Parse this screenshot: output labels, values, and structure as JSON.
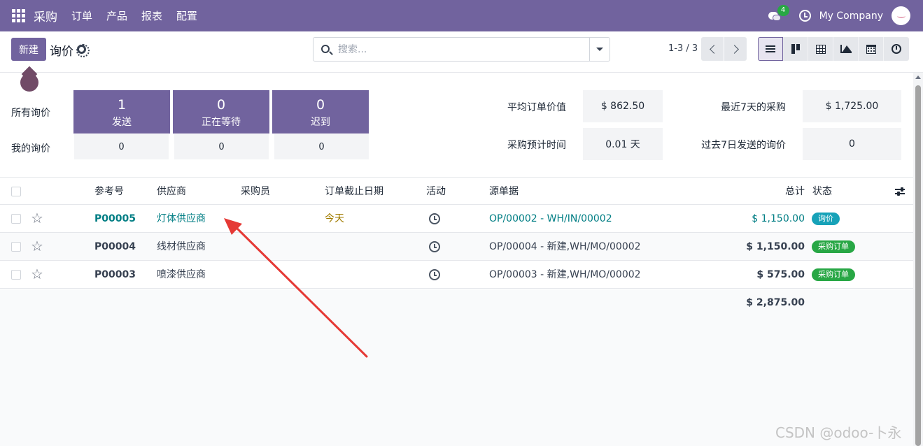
{
  "topbar": {
    "app_name": "采购",
    "menu": [
      "订单",
      "产品",
      "报表",
      "配置"
    ],
    "chat_count": "4",
    "company": "My Company",
    "icons": [
      "apps-grid-icon",
      "chat-icon",
      "clock-icon",
      "avatar"
    ]
  },
  "control": {
    "new_label": "新建",
    "title": "询价",
    "search_placeholder": "搜索...",
    "pager": "1-3 / 3",
    "views": [
      "list-view-icon",
      "kanban-view-icon",
      "pivot-view-icon",
      "graph-view-icon",
      "calendar-view-icon",
      "activity-view-icon"
    ],
    "active_view": "list"
  },
  "dashboard": {
    "row_all": "所有询价",
    "row_mine": "我的询价",
    "tiles": [
      {
        "count": "1",
        "label": "发送",
        "mine": "0"
      },
      {
        "count": "0",
        "label": "正在等待",
        "mine": "0"
      },
      {
        "count": "0",
        "label": "迟到",
        "mine": "0"
      }
    ],
    "metrics": [
      {
        "label": "平均订单价值",
        "value": "$ 862.50"
      },
      {
        "label": "最近7天的采购",
        "value": "$ 1,725.00"
      },
      {
        "label": "采购预计时间",
        "value": "0.01 天"
      },
      {
        "label": "过去7日发送的询价",
        "value": "0"
      }
    ]
  },
  "table": {
    "headers": {
      "reference": "参考号",
      "vendor": "供应商",
      "buyer": "采购员",
      "deadline": "订单截止日期",
      "activity": "活动",
      "source": "源单据",
      "total": "总计",
      "status": "状态"
    },
    "rows": [
      {
        "reference": "P00005",
        "vendor": "灯体供应商",
        "deadline": "今天",
        "source": "OP/00002 - WH/IN/00002",
        "total": "$ 1,150.00",
        "status": "询价"
      },
      {
        "reference": "P00004",
        "vendor": "线材供应商",
        "deadline": "",
        "source": "OP/00004 - 新建,WH/MO/00002",
        "total": "$ 1,150.00",
        "status": "采购订单"
      },
      {
        "reference": "P00003",
        "vendor": "喷漆供应商",
        "deadline": "",
        "source": "OP/00003 - 新建,WH/MO/00002",
        "total": "$ 575.00",
        "status": "采购订单"
      }
    ],
    "grand_total": "$ 2,875.00"
  },
  "watermark": "CSDN @odoo-卜永",
  "colors": {
    "brand": "#71639e",
    "link": "#017e84",
    "badge_rfq": "#17a2b8",
    "badge_po": "#28a745",
    "arrow": "#e53935"
  }
}
